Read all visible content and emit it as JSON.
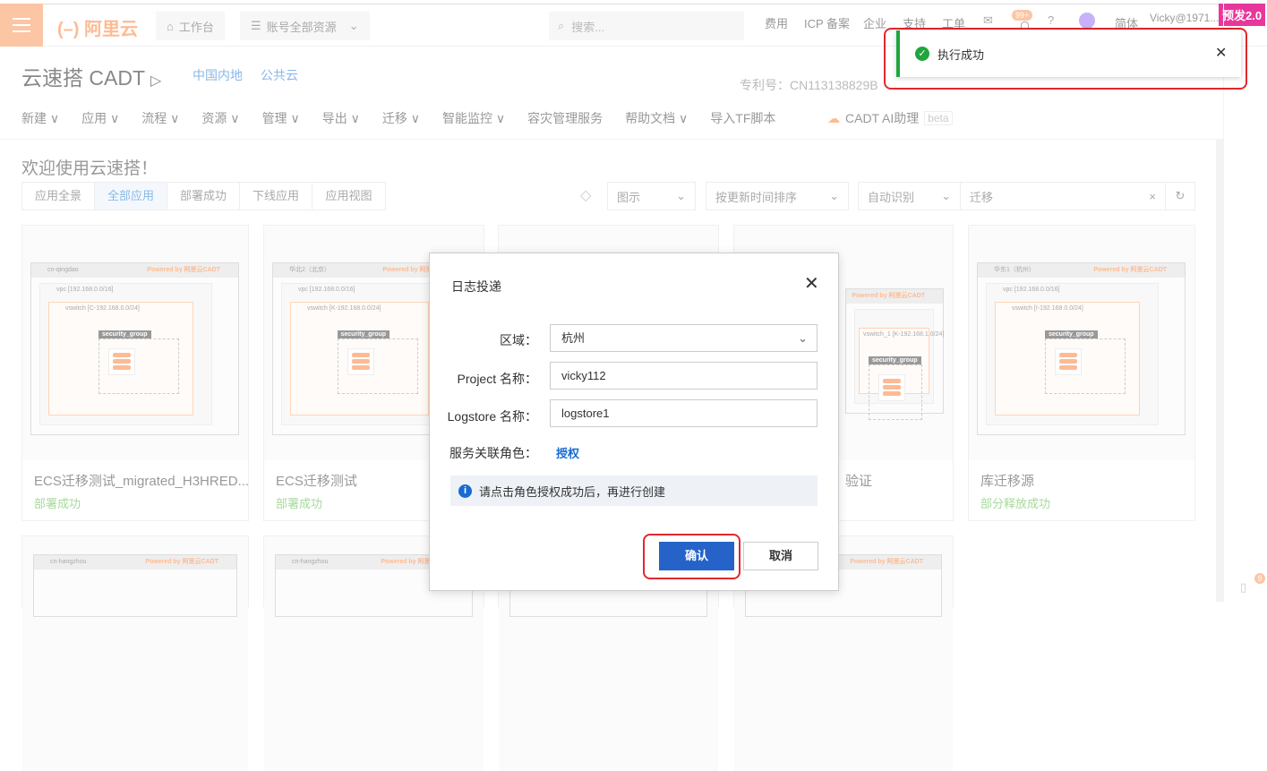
{
  "topbar": {
    "logo": "阿里云",
    "workbench": "工作台",
    "resources": "账号全部资源",
    "search_placeholder": "搜索...",
    "links": [
      "费用",
      "ICP 备案",
      "企业",
      "支持",
      "工单",
      "简体"
    ],
    "badge": "99+",
    "user": "Vicky@1971...",
    "env_badge": "预发2.0"
  },
  "header": {
    "title": "云速搭 CADT",
    "region": "中国内地",
    "cloud": "公共云",
    "patent": "专利号：CN113138829B"
  },
  "nav": {
    "items": [
      "新建 ∨",
      "应用 ∨",
      "流程 ∨",
      "资源 ∨",
      "管理 ∨",
      "导出 ∨",
      "迁移 ∨",
      "智能监控 ∨",
      "容灾管理服务",
      "帮助文档 ∨",
      "导入TF脚本"
    ],
    "ai": "CADT AI助理",
    "beta": "beta"
  },
  "main": {
    "welcome": "欢迎使用云速搭！",
    "tabs": [
      "应用全景",
      "全部应用",
      "部署成功",
      "下线应用",
      "应用视图"
    ],
    "filters": {
      "legend": "图示",
      "sort": "按更新时间排序",
      "detect": "自动识别",
      "query": "迁移"
    },
    "cards": [
      {
        "region": "cn-qingdao",
        "vpc": "vpc [192.168.0.0/16]",
        "vswitch": "vswitch [C-192.168.0.0/24]",
        "title": "ECS迁移测试_migrated_H3HRED...",
        "status": "部署成功"
      },
      {
        "region": "华北2（北京）",
        "vpc": "vpc [192.168.0.0/16]",
        "vswitch": "vswitch [K-192.168.0.0/24]",
        "title": "ECS迁移测试",
        "status": "部署成功"
      },
      {
        "region": "",
        "vpc": "",
        "vswitch": "",
        "title": "",
        "status": ""
      },
      {
        "region": "",
        "vpc": "",
        "vswitch": "vswitch_1 [K-192.168.1.0/24]",
        "title": "验证",
        "status": ""
      },
      {
        "region": "华东1（杭州）",
        "vpc": "vpc [192.168.0.0/16]",
        "vswitch": "vswitch [I-192.168.0.0/24]",
        "title": "库迁移源",
        "status": "部分释放成功"
      }
    ],
    "row2": [
      "cn-hangzhou",
      "cn-hangzhou"
    ],
    "powered": "Powered by 阿里云CADT",
    "sg": "security_group",
    "ecs": "ecs",
    "rds": "rds"
  },
  "dialog": {
    "title": "日志投递",
    "region_label": "区域：",
    "region_value": "杭州",
    "project_label": "Project 名称：",
    "project_value": "vicky112",
    "logstore_label": "Logstore 名称：",
    "logstore_value": "logstore1",
    "role_label": "服务关联角色：",
    "role_link": "授权",
    "info": "请点击角色授权成功后，再进行创建",
    "confirm": "确认",
    "cancel": "取消"
  },
  "toast": {
    "message": "执行成功"
  },
  "side": {
    "doc_badge": "9"
  }
}
